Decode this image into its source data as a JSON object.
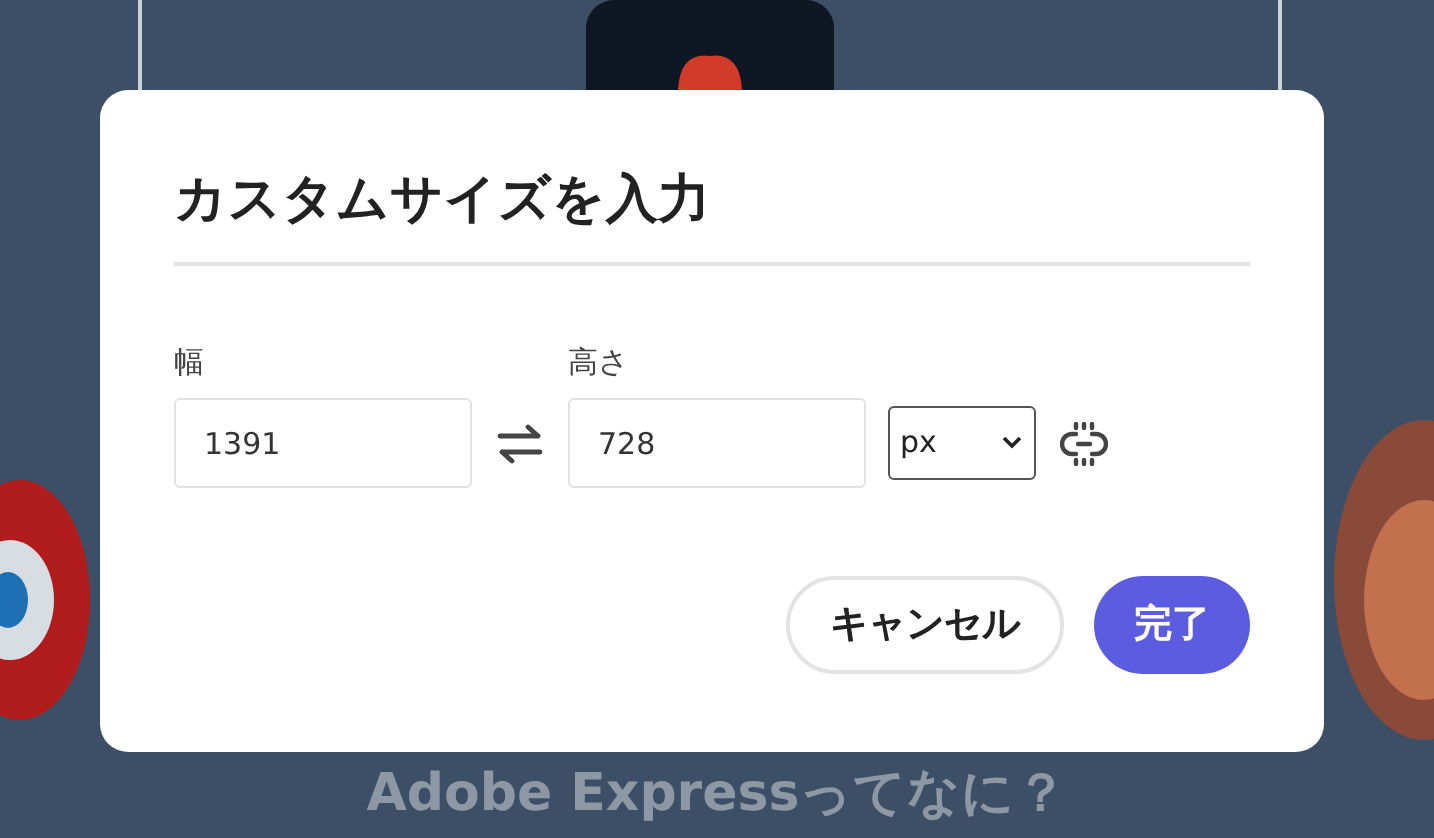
{
  "dialog": {
    "title": "カスタムサイズを入力",
    "fields": [
      {
        "label": "幅",
        "value": "1391"
      },
      {
        "label": "高さ",
        "value": "728"
      }
    ],
    "unit": "px",
    "aspect_locked": false,
    "buttons": [
      {
        "label": "キャンセル",
        "kind": "secondary"
      },
      {
        "label": "完了",
        "kind": "primary"
      }
    ]
  },
  "background_heading": "Adobe Expressってなに？"
}
